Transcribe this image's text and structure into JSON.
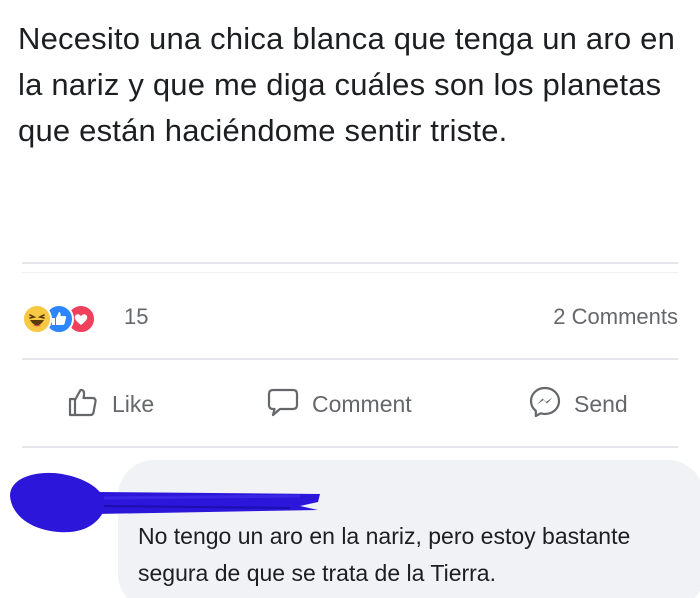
{
  "post": {
    "text": "Necesito una chica blanca que tenga un aro en la nariz y que me diga cuáles son los planetas que están haciéndome sentir triste."
  },
  "reactions": {
    "icons": [
      "haha-icon",
      "like-icon",
      "love-icon"
    ],
    "count": "15",
    "comments_label": "2 Comments"
  },
  "actions": {
    "like_label": "Like",
    "comment_label": "Comment",
    "send_label": "Send"
  },
  "comment": {
    "text": "No tengo un aro en la nariz, pero estoy bastante segura de que se trata de la Tierra."
  },
  "colors": {
    "text_primary": "#1c1e21",
    "text_secondary": "#65676b",
    "like_blue": "#2d86ff",
    "love_red": "#f0405b",
    "haha_yellow": "#f7c843",
    "scribble_blue": "#2b16d9",
    "bubble_bg": "#f0f2f5"
  }
}
